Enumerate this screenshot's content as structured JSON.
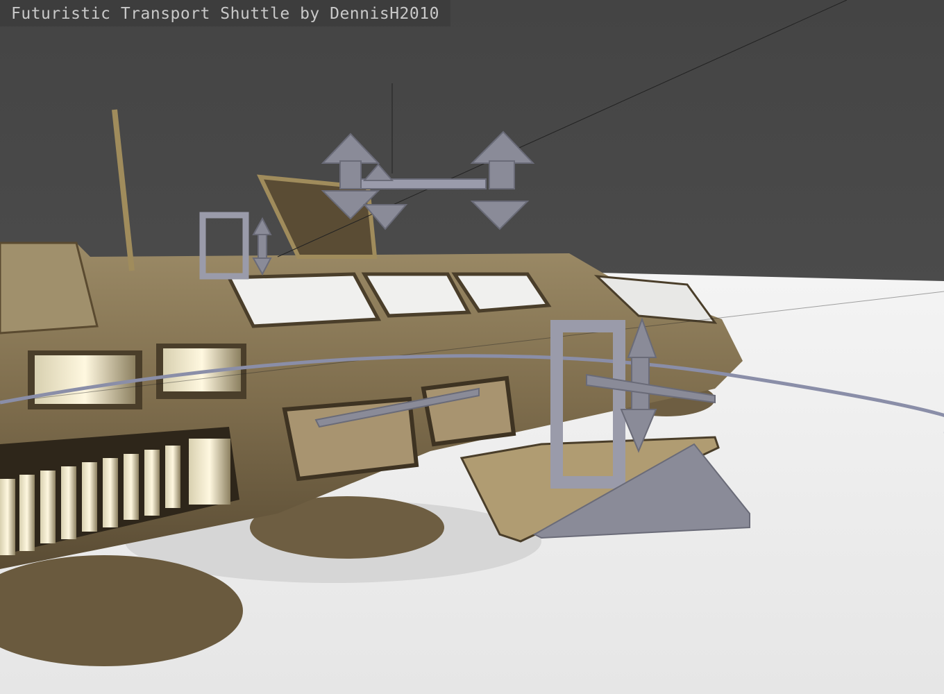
{
  "viewer": {
    "title": "Futuristic Transport Shuttle by DennisH2010"
  },
  "colors": {
    "background": "#4a4a4a",
    "floor": "#eeeeee",
    "hull": "#8a7a5a",
    "gizmo": "#8a8b98"
  }
}
